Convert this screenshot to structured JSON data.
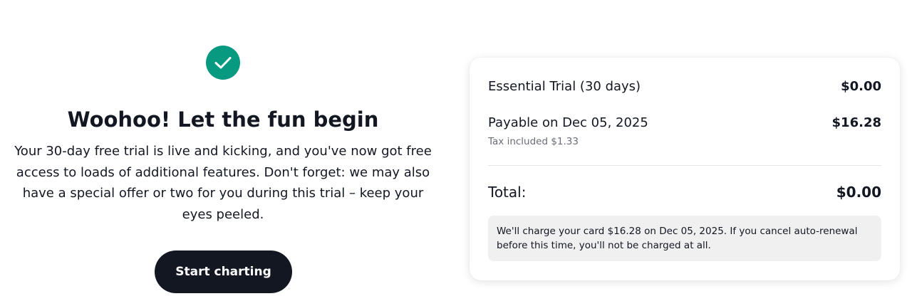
{
  "confirmation": {
    "title": "Woohoo! Let the fun begin",
    "description": "Your 30-day free trial is live and kicking, and you've now got free access to loads of additional features. Don't forget: we may also have a special offer or two for you during this trial – keep your eyes peeled.",
    "cta_label": "Start charting",
    "icon": "check-circle-icon",
    "accent_color": "#089981"
  },
  "summary": {
    "plan_label": "Essential Trial (30 days)",
    "plan_price": "$0.00",
    "payable_label": "Payable on Dec 05, 2025",
    "payable_price": "$16.28",
    "tax_note": "Tax included $1.33",
    "total_label": "Total:",
    "total_price": "$0.00",
    "charge_note": "We'll charge your card $16.28 on Dec 05, 2025. If you cancel auto-renewal before this time, you'll not be charged at all."
  }
}
